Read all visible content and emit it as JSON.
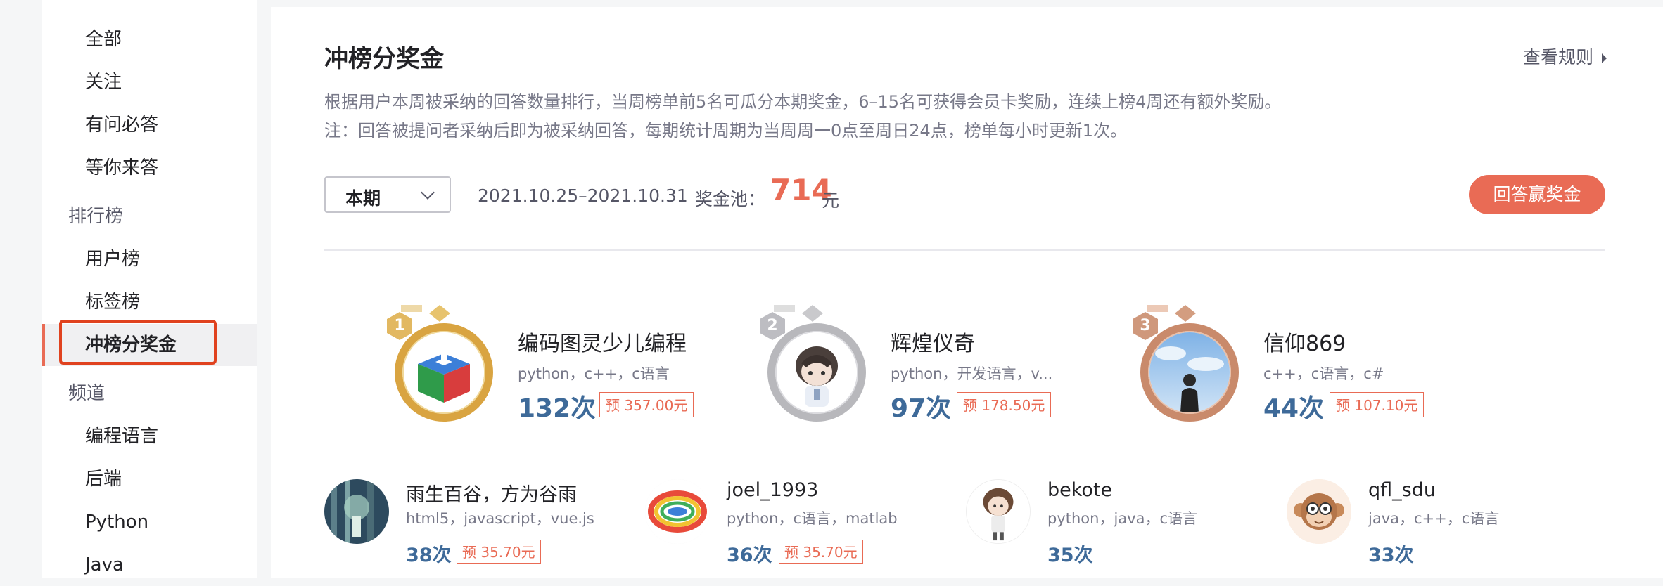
{
  "sidebar": {
    "items": [
      {
        "label": "全部"
      },
      {
        "label": "关注"
      },
      {
        "label": "有问必答"
      },
      {
        "label": "等你来答"
      }
    ],
    "group_rank": "排行榜",
    "rank_items": [
      {
        "label": "用户榜"
      },
      {
        "label": "标签榜"
      },
      {
        "label": "冲榜分奖金"
      }
    ],
    "group_channel": "频道",
    "channel_items": [
      {
        "label": "编程语言"
      },
      {
        "label": "后端"
      },
      {
        "label": "Python"
      },
      {
        "label": "Java"
      }
    ]
  },
  "main": {
    "title": "冲榜分奖金",
    "rules_link": "查看规则",
    "desc_line1": "根据用户本周被采纳的回答数量排行，当周榜单前5名可瓜分本期奖金，6–15名可获得会员卡奖励，连续上榜4周还有额外奖励。",
    "desc_line2": "注：回答被提问者采纳后即为被采纳回答，每期统计周期为当周周一0点至周日24点，榜单每小时更新1次。",
    "period_select": "本期",
    "date_range": "2021.10.25–2021.10.31",
    "pool_label": "奖金池：",
    "pool_amount": "714",
    "pool_unit": "元",
    "answer_button": "回答赢奖金"
  },
  "top3": [
    {
      "rank": "1",
      "name": "编码图灵少儿编程",
      "tags": "python，c++，c语言",
      "count": "132次",
      "prize": "预 357.00元"
    },
    {
      "rank": "2",
      "name": "辉煌仪奇",
      "tags": "python，开发语言，v...",
      "count": "97次",
      "prize": "预 178.50元"
    },
    {
      "rank": "3",
      "name": "信仰869",
      "tags": "c++，c语言，c#",
      "count": "44次",
      "prize": "预 107.10元"
    }
  ],
  "others": [
    {
      "name": "雨生百谷，方为谷雨",
      "tags": "html5，javascript，vue.js",
      "count": "38次",
      "prize": "预 35.70元"
    },
    {
      "name": "joel_1993",
      "tags": "python，c语言，matlab",
      "count": "36次",
      "prize": "预 35.70元"
    },
    {
      "name": "bekote",
      "tags": "python，java，c语言",
      "count": "35次",
      "prize": ""
    },
    {
      "name": "qfl_sdu",
      "tags": "java，c++，c语言",
      "count": "33次",
      "prize": ""
    }
  ],
  "colors": {
    "accent": "#e96b55",
    "count_blue": "#3e6a99",
    "gold": "#d9a441",
    "silver": "#b8b8bc",
    "bronze": "#c98a6b"
  }
}
